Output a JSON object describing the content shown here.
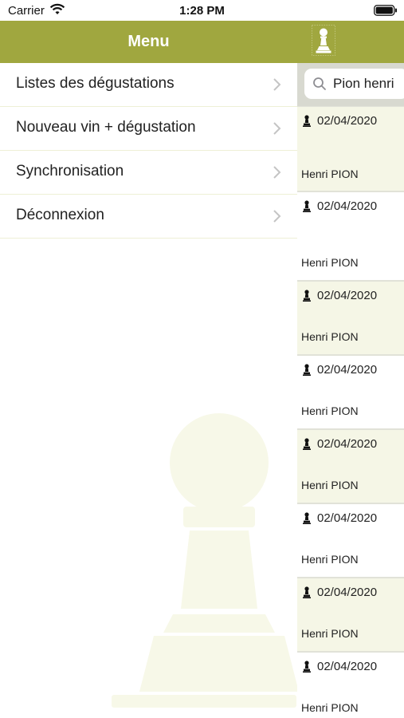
{
  "status_bar": {
    "carrier": "Carrier",
    "time": "1:28 PM"
  },
  "nav": {
    "title": "Menu"
  },
  "menu": {
    "items": [
      {
        "label": "Listes des dégustations"
      },
      {
        "label": "Nouveau vin + dégustation"
      },
      {
        "label": "Synchronisation"
      },
      {
        "label": "Déconnexion"
      }
    ]
  },
  "search": {
    "value": "Pion henri"
  },
  "tastings": [
    {
      "date": "02/04/2020",
      "name": "Henri PION"
    },
    {
      "date": "02/04/2020",
      "name": "Henri PION"
    },
    {
      "date": "02/04/2020",
      "name": "Henri PION"
    },
    {
      "date": "02/04/2020",
      "name": "Henri PION"
    },
    {
      "date": "02/04/2020",
      "name": "Henri PION"
    },
    {
      "date": "02/04/2020",
      "name": "Henri PION"
    },
    {
      "date": "02/04/2020",
      "name": "Henri PION"
    },
    {
      "date": "02/04/2020",
      "name": "Henri PION"
    }
  ],
  "colors": {
    "accent": "#a0a73f",
    "row_alt": "#f5f6e6",
    "separator": "#e1e2d8"
  }
}
